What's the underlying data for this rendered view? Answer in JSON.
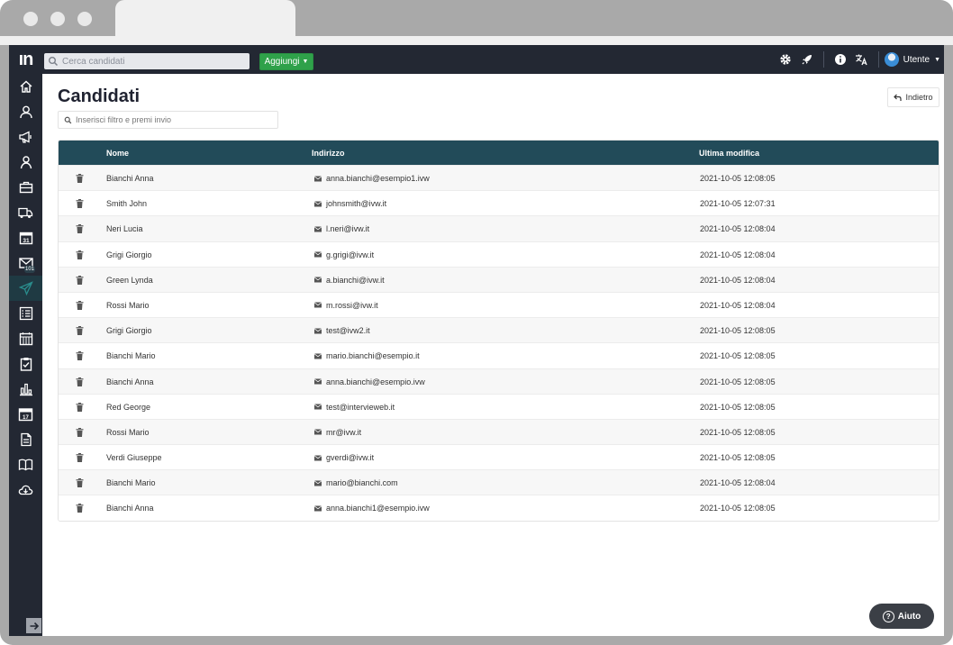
{
  "browser": {},
  "topbar": {
    "logo_text": "ın",
    "search_placeholder": "Cerca candidati",
    "add_button_label": "Aggiungi",
    "user_label": "Utente",
    "icons": [
      "gear-icon",
      "rocket-icon",
      "info-icon",
      "translate-icon"
    ]
  },
  "sidebar": {
    "items": [
      {
        "icon": "home-icon"
      },
      {
        "icon": "user-icon"
      },
      {
        "icon": "megaphone-icon"
      },
      {
        "icon": "candidate-icon"
      },
      {
        "icon": "briefcase-icon"
      },
      {
        "icon": "truck-icon"
      },
      {
        "icon": "calendar-icon",
        "text": "31"
      },
      {
        "icon": "mail-icon",
        "badge": "101"
      },
      {
        "icon": "send-icon"
      },
      {
        "icon": "checklist-icon"
      },
      {
        "icon": "calendar-grid-icon"
      },
      {
        "icon": "clipboard-check-icon"
      },
      {
        "icon": "bar-chart-icon"
      },
      {
        "icon": "date-block-icon",
        "text": "17"
      },
      {
        "icon": "document-icon"
      },
      {
        "icon": "book-icon"
      },
      {
        "icon": "cloud-download-icon"
      }
    ]
  },
  "page": {
    "title": "Candidati",
    "back_label": "Indietro",
    "filter_placeholder": "Inserisci filtro e premi invio"
  },
  "table": {
    "headers": {
      "name": "Nome",
      "address": "Indirizzo",
      "modified": "Ultima modifica"
    },
    "rows": [
      {
        "name": "Bianchi Anna",
        "email": "anna.bianchi@esempio1.ivw",
        "modified": "2021-10-05 12:08:05"
      },
      {
        "name": "Smith John",
        "email": "johnsmith@ivw.it",
        "modified": "2021-10-05 12:07:31"
      },
      {
        "name": "Neri Lucia",
        "email": "l.neri@ivw.it",
        "modified": "2021-10-05 12:08:04"
      },
      {
        "name": "Grigi Giorgio",
        "email": "g.grigi@ivw.it",
        "modified": "2021-10-05 12:08:04"
      },
      {
        "name": "Green Lynda",
        "email": "a.bianchi@ivw.it",
        "modified": "2021-10-05 12:08:04"
      },
      {
        "name": "Rossi Mario",
        "email": "m.rossi@ivw.it",
        "modified": "2021-10-05 12:08:04"
      },
      {
        "name": "Grigi Giorgio",
        "email": "test@ivw2.it",
        "modified": "2021-10-05 12:08:05"
      },
      {
        "name": "Bianchi Mario",
        "email": "mario.bianchi@esempio.it",
        "modified": "2021-10-05 12:08:05"
      },
      {
        "name": "Bianchi Anna",
        "email": "anna.bianchi@esempio.ivw",
        "modified": "2021-10-05 12:08:05"
      },
      {
        "name": "Red George",
        "email": "test@interviewеb.it",
        "modified": "2021-10-05 12:08:05"
      },
      {
        "name": "Rossi Mario",
        "email": "mr@ivw.it",
        "modified": "2021-10-05 12:08:05"
      },
      {
        "name": "Verdi Giuseppe",
        "email": "gverdi@ivw.it",
        "modified": "2021-10-05 12:08:05"
      },
      {
        "name": "Bianchi Mario",
        "email": "mario@bianchi.com",
        "modified": "2021-10-05 12:08:04"
      },
      {
        "name": "Bianchi Anna",
        "email": "anna.bianchi1@esempio.ivw",
        "modified": "2021-10-05 12:08:05"
      }
    ]
  },
  "help": {
    "label": "Aiuto"
  },
  "colors": {
    "sidebar_bg": "#232833",
    "table_header_bg": "#224b59",
    "add_button": "#2fa14a",
    "active_icon": "#2a8c8c"
  }
}
